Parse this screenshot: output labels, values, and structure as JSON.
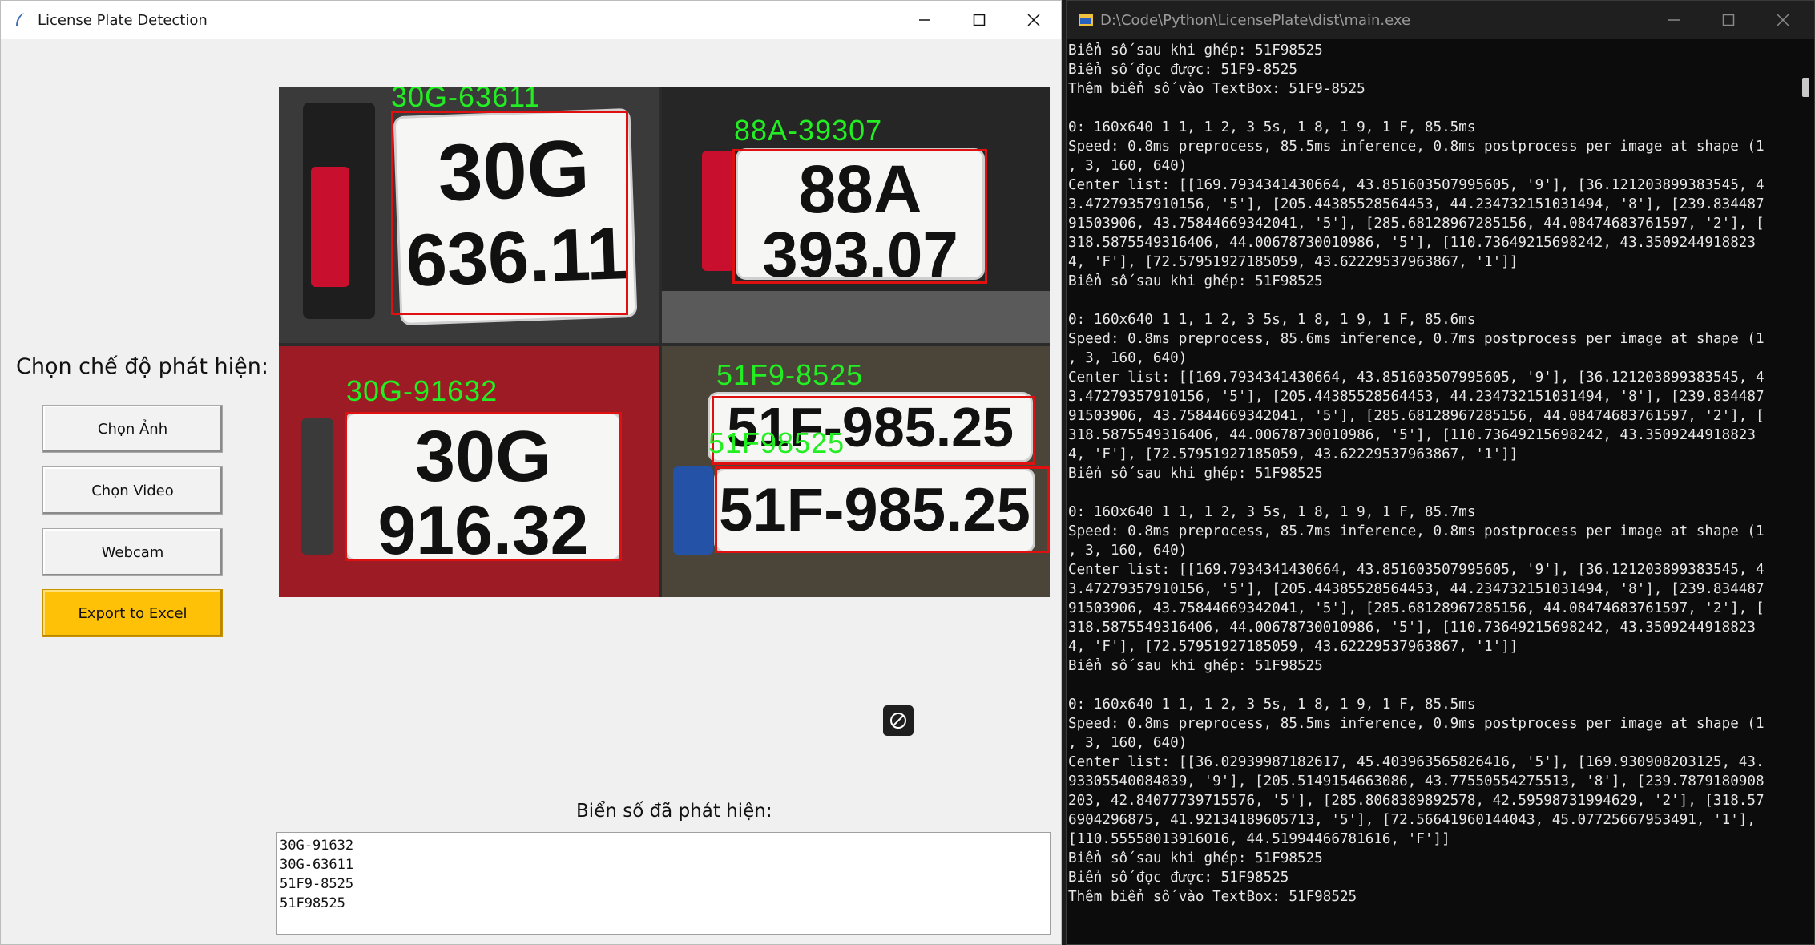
{
  "app": {
    "title": "License Plate Detection",
    "mode_label": "Chọn chế độ phát hiện:",
    "buttons": {
      "choose_image": "Chọn Ảnh",
      "choose_video": "Chọn Video",
      "webcam": "Webcam",
      "export_excel": "Export to Excel"
    },
    "detected_label": "Biển số đã phát hiện:",
    "detected_plates": [
      "30G-91632",
      "30G-63611",
      "51F9-8525",
      "51F98525"
    ],
    "image_panels": [
      {
        "label": "30G-63611",
        "plate_line1": "30G",
        "plate_line2": "636.11"
      },
      {
        "label": "88A-39307",
        "plate_line1": "88A",
        "plate_line2": "393.07"
      },
      {
        "label": "30G-91632",
        "plate_line1": "30G",
        "plate_line2": "916.32"
      },
      {
        "label": "51F9-8525",
        "label2": "51F98525",
        "plate_top": "51F-985.25",
        "plate_bottom": "51F-985.25"
      }
    ],
    "colors": {
      "accent_button": "#ffc107",
      "detection_box": "#e01010",
      "detection_text": "#22ee22"
    }
  },
  "console": {
    "title": "D:\\Code\\Python\\LicensePlate\\dist\\main.exe",
    "lines": [
      "Biển số sau khi ghép: 51F98525",
      "Biển số đọc được: 51F9-8525",
      "Thêm biển số vào TextBox: 51F9-8525",
      "",
      "0: 160x640 1 1, 1 2, 3 5s, 1 8, 1 9, 1 F, 85.5ms",
      "Speed: 0.8ms preprocess, 85.5ms inference, 0.8ms postprocess per image at shape (1",
      ", 3, 160, 640)",
      "Center list: [[169.7934341430664, 43.851603507995605, '9'], [36.121203899383545, 4",
      "3.47279357910156, '5'], [205.44385528564453, 44.234732151031494, '8'], [239.834487",
      "91503906, 43.75844669342041, '5'], [285.68128967285156, 44.08474683761597, '2'], [",
      "318.5875549316406, 44.00678730010986, '5'], [110.73649215698242, 43.3509244918823",
      "4, 'F'], [72.57951927185059, 43.62229537963867, '1']]",
      "Biển số sau khi ghép: 51F98525",
      "",
      "0: 160x640 1 1, 1 2, 3 5s, 1 8, 1 9, 1 F, 85.6ms",
      "Speed: 0.8ms preprocess, 85.6ms inference, 0.7ms postprocess per image at shape (1",
      ", 3, 160, 640)",
      "Center list: [[169.7934341430664, 43.851603507995605, '9'], [36.121203899383545, 4",
      "3.47279357910156, '5'], [205.44385528564453, 44.234732151031494, '8'], [239.834487",
      "91503906, 43.75844669342041, '5'], [285.68128967285156, 44.08474683761597, '2'], [",
      "318.5875549316406, 44.00678730010986, '5'], [110.73649215698242, 43.3509244918823",
      "4, 'F'], [72.57951927185059, 43.62229537963867, '1']]",
      "Biển số sau khi ghép: 51F98525",
      "",
      "0: 160x640 1 1, 1 2, 3 5s, 1 8, 1 9, 1 F, 85.7ms",
      "Speed: 0.8ms preprocess, 85.7ms inference, 0.8ms postprocess per image at shape (1",
      ", 3, 160, 640)",
      "Center list: [[169.7934341430664, 43.851603507995605, '9'], [36.121203899383545, 4",
      "3.47279357910156, '5'], [205.44385528564453, 44.234732151031494, '8'], [239.834487",
      "91503906, 43.75844669342041, '5'], [285.68128967285156, 44.08474683761597, '2'], [",
      "318.5875549316406, 44.00678730010986, '5'], [110.73649215698242, 43.3509244918823",
      "4, 'F'], [72.57951927185059, 43.62229537963867, '1']]",
      "Biển số sau khi ghép: 51F98525",
      "",
      "0: 160x640 1 1, 1 2, 3 5s, 1 8, 1 9, 1 F, 85.5ms",
      "Speed: 0.8ms preprocess, 85.5ms inference, 0.9ms postprocess per image at shape (1",
      ", 3, 160, 640)",
      "Center list: [[36.02939987182617, 45.403963565826416, '5'], [169.930908203125, 43.",
      "93305540084839, '9'], [205.5149154663086, 43.77550554275513, '8'], [239.7879180908",
      "203, 42.84077739715576, '5'], [285.8068389892578, 42.59598731994629, '2'], [318.57",
      "6904296875, 41.92134189605713, '5'], [72.56641960144043, 45.07725667953491, '1'],",
      "[110.55558013916016, 44.51994466781616, 'F']]",
      "Biển số sau khi ghép: 51F98525",
      "Biển số đọc được: 51F98525",
      "Thêm biển số vào TextBox: 51F98525"
    ]
  }
}
